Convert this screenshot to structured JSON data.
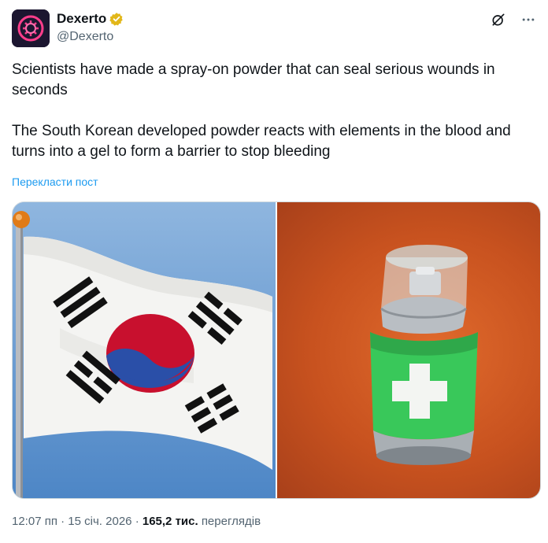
{
  "author": {
    "name": "Dexerto",
    "handle": "@Dexerto"
  },
  "tweet": {
    "text": "Scientists have made a spray-on powder that can seal serious wounds in seconds\n\nThe South Korean developed powder reacts with elements in the blood and turns into a gel to form a barrier to stop bleeding",
    "translate_label": "Перекласти пост"
  },
  "media": {
    "left_image": "south-korean-flag",
    "right_image": "green-spray-can"
  },
  "meta": {
    "time": "12:07 пп",
    "date": "15 січ. 2026",
    "views_count": "165,2 тис.",
    "views_label": "переглядів"
  },
  "colors": {
    "accent": "#1d9bf0",
    "verified": "#e2b719",
    "secondary_text": "#536471"
  }
}
